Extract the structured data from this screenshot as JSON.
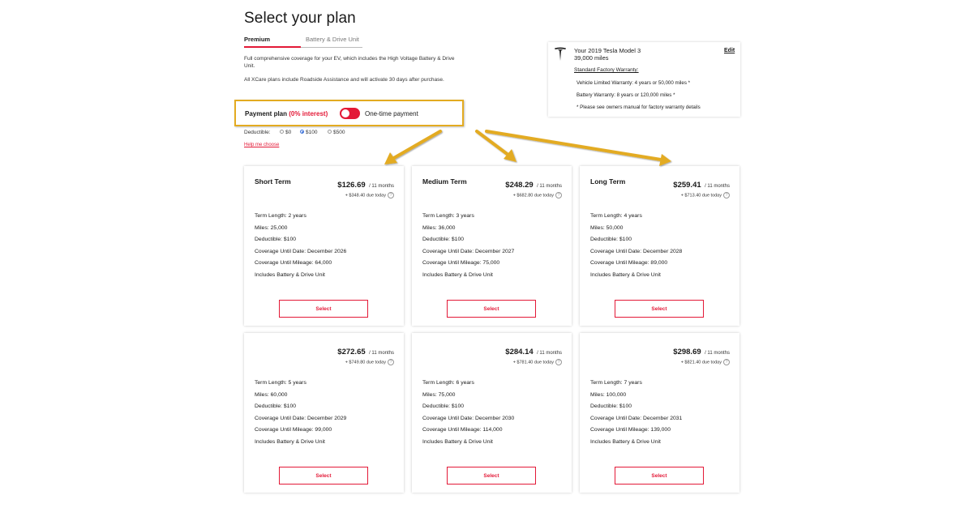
{
  "page": {
    "title": "Select your plan",
    "tabs": [
      {
        "label": "Premium",
        "active": true
      },
      {
        "label": "Battery & Drive Unit",
        "active": false
      }
    ],
    "description_1": "Full comprehensive coverage for your EV, which includes the High Voltage Battery & Drive Unit.",
    "description_2": "All XCare plans include Roadside Assistance and will activate 30 days after purchase."
  },
  "payment": {
    "label": "Payment plan",
    "interest": "(0% interest)",
    "toggle_on": true,
    "option_label": "One-time payment"
  },
  "deductible": {
    "label": "Deductible:",
    "options": [
      "$0",
      "$100",
      "$500"
    ],
    "selected": "$100",
    "help_link": "Help me choose"
  },
  "vehicle": {
    "title": "Your 2019 Tesla Model 3",
    "miles": "39,000 miles",
    "edit_label": "Edit",
    "warranty_heading": "Standard Factory Warranty:",
    "warranty_lines": [
      "Vehicle Limited Warranty: 4 years or 50,000 miles *",
      "Battery Warranty: 8 years or 120,000 miles *",
      "* Please see owners manual for factory warranty details"
    ]
  },
  "plans": [
    {
      "name": "Short Term",
      "price": "$126.69",
      "per": "/ 11 months",
      "due": "+ $348.40 due today",
      "details": [
        "Term Length: 2 years",
        "Miles: 25,000",
        "Deductible: $100",
        "Coverage Until Date: December 2026",
        "Coverage Until Mileage: 64,000",
        "Includes Battery & Drive Unit"
      ],
      "select": "Select"
    },
    {
      "name": "Medium Term",
      "price": "$248.29",
      "per": "/ 11 months",
      "due": "+ $682.80 due today",
      "details": [
        "Term Length: 3 years",
        "Miles: 36,000",
        "Deductible: $100",
        "Coverage Until Date: December 2027",
        "Coverage Until Mileage: 75,000",
        "Includes Battery & Drive Unit"
      ],
      "select": "Select"
    },
    {
      "name": "Long Term",
      "price": "$259.41",
      "per": "/ 11 months",
      "due": "+ $713.40 due today",
      "details": [
        "Term Length: 4 years",
        "Miles: 50,000",
        "Deductible: $100",
        "Coverage Until Date: December 2028",
        "Coverage Until Mileage: 89,000",
        "Includes Battery & Drive Unit"
      ],
      "select": "Select"
    },
    {
      "name": "",
      "price": "$272.65",
      "per": "/ 11 months",
      "due": "+ $749.80 due today",
      "details": [
        "Term Length: 5 years",
        "Miles: 60,000",
        "Deductible: $100",
        "Coverage Until Date: December 2029",
        "Coverage Until Mileage: 99,000",
        "Includes Battery & Drive Unit"
      ],
      "select": "Select"
    },
    {
      "name": "",
      "price": "$284.14",
      "per": "/ 11 months",
      "due": "+ $781.40 due today",
      "details": [
        "Term Length: 6 years",
        "Miles: 75,000",
        "Deductible: $100",
        "Coverage Until Date: December 2030",
        "Coverage Until Mileage: 114,000",
        "Includes Battery & Drive Unit"
      ],
      "select": "Select"
    },
    {
      "name": "",
      "price": "$298.69",
      "per": "/ 11 months",
      "due": "+ $821.40 due today",
      "details": [
        "Term Length: 7 years",
        "Miles: 100,000",
        "Deductible: $100",
        "Coverage Until Date: December 2031",
        "Coverage Until Mileage: 139,000",
        "Includes Battery & Drive Unit"
      ],
      "select": "Select"
    }
  ],
  "colors": {
    "accent_red": "#e31937",
    "highlight_gold": "#e3ab21"
  }
}
